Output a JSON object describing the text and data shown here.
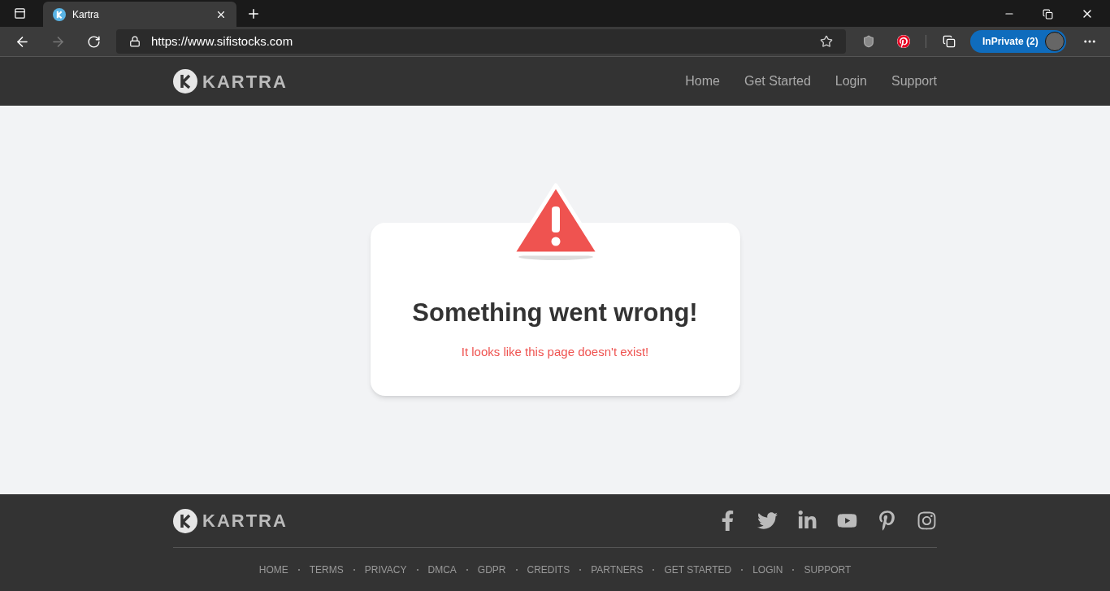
{
  "browser": {
    "tab": {
      "title": "Kartra"
    },
    "url": "https://www.sifistocks.com",
    "profile_label": "InPrivate (2)"
  },
  "header": {
    "logo_text": "KARTRA",
    "nav": [
      "Home",
      "Get Started",
      "Login",
      "Support"
    ]
  },
  "error_card": {
    "title": "Something went wrong!",
    "message": "It looks like this page doesn't exist!"
  },
  "footer": {
    "logo_text": "KARTRA",
    "social": [
      {
        "kind": "facebook"
      },
      {
        "kind": "twitter"
      },
      {
        "kind": "linkedin"
      },
      {
        "kind": "youtube"
      },
      {
        "kind": "pinterest"
      },
      {
        "kind": "instagram"
      }
    ],
    "links": [
      "HOME",
      "TERMS",
      "PRIVACY",
      "DMCA",
      "GDPR",
      "CREDITS",
      "PARTNERS",
      "GET STARTED",
      "LOGIN",
      "SUPPORT"
    ]
  }
}
